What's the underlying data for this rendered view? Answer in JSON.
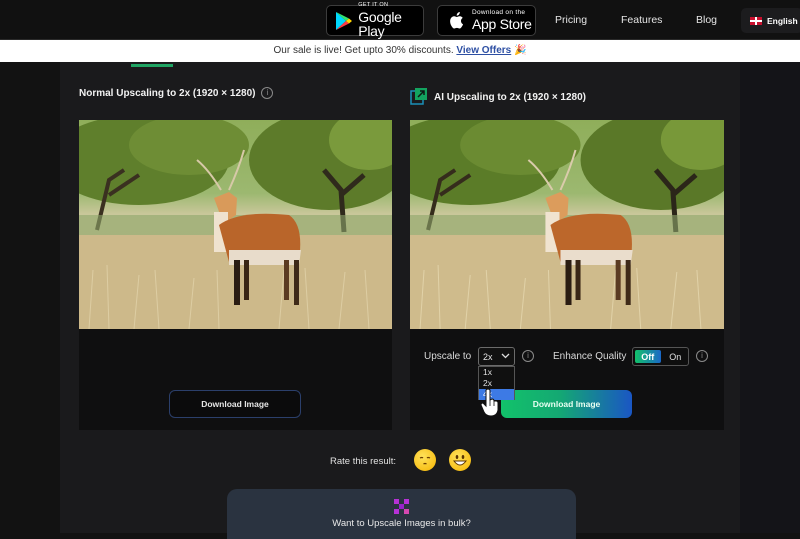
{
  "header": {
    "google_play": {
      "small": "GET IT ON",
      "big": "Google Play"
    },
    "app_store": {
      "small": "Download on the",
      "big": "App Store"
    },
    "nav": [
      "Pricing",
      "Features",
      "Blog"
    ],
    "language": "English"
  },
  "promo": {
    "text": "Our sale is live! Get upto 30% discounts.",
    "link": "View Offers",
    "emoji": "🎉"
  },
  "panels": {
    "normal": {
      "title": "Normal Upscaling to 2x (1920 × 1280)",
      "download_label": "Download Image"
    },
    "ai": {
      "title": "AI Upscaling to 2x (1920 × 1280)",
      "upscale_label": "Upscale to",
      "upscale_value": "2x",
      "upscale_options": [
        "1x",
        "2x",
        "4x"
      ],
      "upscale_highlighted": "4x",
      "enhance_label": "Enhance Quality",
      "toggle": {
        "off": "Off",
        "on": "On",
        "selected": "Off"
      },
      "download_label": "Download Image"
    }
  },
  "rating": {
    "label": "Rate this result:",
    "options": [
      "unamused-face",
      "grinning-face"
    ]
  },
  "bulk": {
    "text": "Want to Upscale Images in bulk?"
  },
  "colors": {
    "accent_green": "#1fa463",
    "accent_blue": "#1a56c4",
    "link_blue": "#2d4fa3"
  }
}
